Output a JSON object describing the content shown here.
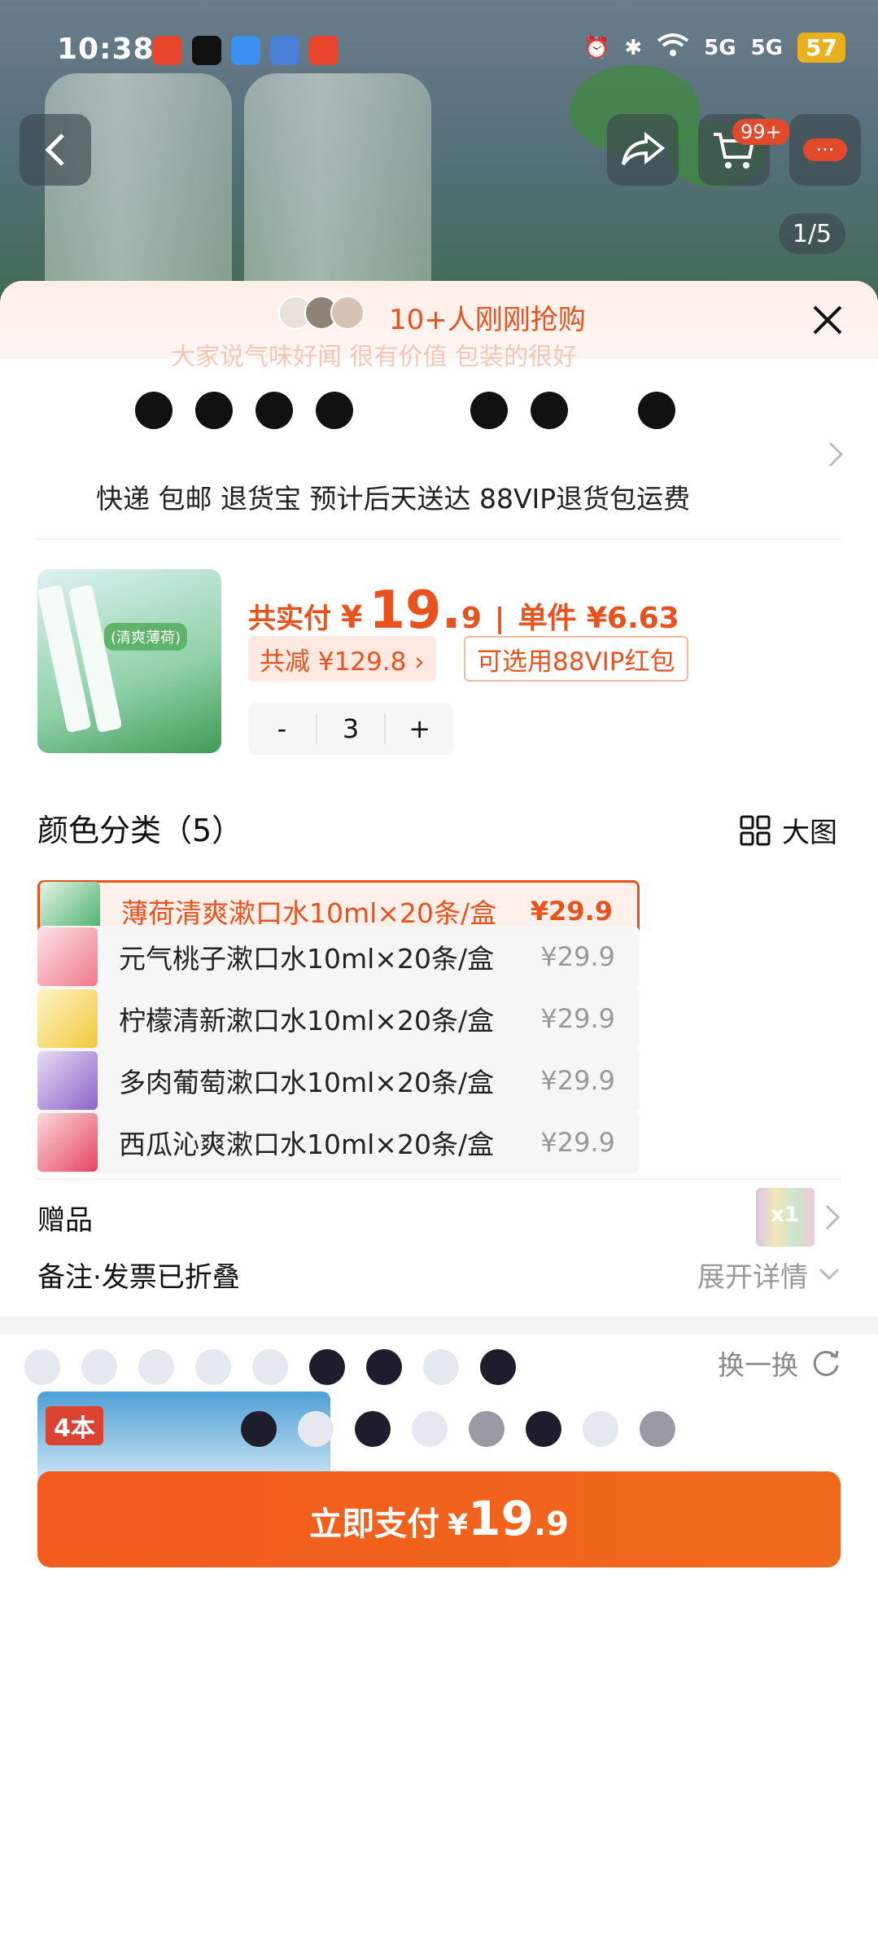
{
  "status_bar": {
    "time": "10:38",
    "network_1": "5G",
    "network_2": "5G",
    "battery": "57"
  },
  "hero": {
    "cart_badge": "99+",
    "more_badge": "···",
    "pager": "1/5"
  },
  "banner": {
    "text": "10+人刚刚抢购",
    "sub_text": "大家说气味好闻 很有价值 包装的很好"
  },
  "shipping": {
    "line": "快递 包邮 退货宝 预计后天送达 88VIP退货包运费"
  },
  "summary": {
    "thumb_tag": "(清爽薄荷)",
    "total_label": "共实付",
    "currency": "¥",
    "total_int": "19.",
    "total_dec": "9",
    "separator": "|",
    "unit_price": "单件 ¥6.63",
    "saved": "共减 ¥129.8 ›",
    "vip_coupon": "可选用88VIP红包",
    "qty_minus": "-",
    "qty": "3",
    "qty_plus": "+"
  },
  "category": {
    "title": "颜色分类（5）",
    "view_label": "大图",
    "options": [
      {
        "name": "薄荷清爽漱口水10ml×20条/盒",
        "price": "¥29.9",
        "color": "#3faa63"
      },
      {
        "name": "元气桃子漱口水10ml×20条/盒",
        "price": "¥29.9",
        "color": "#f1798a"
      },
      {
        "name": "柠檬清新漱口水10ml×20条/盒",
        "price": "¥29.9",
        "color": "#f2c93b"
      },
      {
        "name": "多肉葡萄漱口水10ml×20条/盒",
        "price": "¥29.9",
        "color": "#8b63c9"
      },
      {
        "name": "西瓜沁爽漱口水10ml×20条/盒",
        "price": "¥29.9",
        "color": "#e6455e"
      }
    ]
  },
  "gift": {
    "label": "赠品",
    "count": "x1"
  },
  "remark": {
    "label": "备注·发票已折叠",
    "expand": "展开详情"
  },
  "recommend": {
    "refresh": "换一换",
    "card_badge": "4本"
  },
  "pay": {
    "label": "立即支付",
    "currency": "¥",
    "amount_int": "19",
    "amount_dec": ".9"
  },
  "colors": {
    "accent": "#e8521f",
    "pay": "#f25a1e"
  }
}
